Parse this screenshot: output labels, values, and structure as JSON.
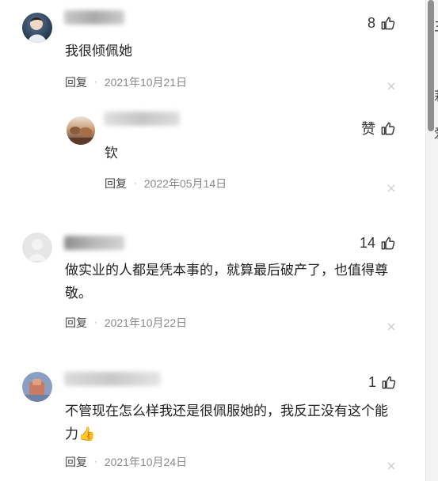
{
  "comments": [
    {
      "likes": "8",
      "text": "我很倾佩她",
      "reply_label": "回复",
      "separator": "·",
      "date": "2021年10月21日",
      "reply": {
        "likes": "赞",
        "text": "钦",
        "reply_label": "回复",
        "separator": "·",
        "date": "2022年05月14日"
      }
    },
    {
      "likes": "14",
      "text": "做实业的人都是凭本事的，就算最后破产了，也值得尊\n敬。",
      "reply_label": "回复",
      "separator": "·",
      "date": "2021年10月22日"
    },
    {
      "likes": "1",
      "text": "不管现在怎么样我还是很佩服她的，我反正没有这个能\n力👍",
      "reply_label": "回复",
      "separator": "·",
      "date": "2021年10月24日"
    }
  ],
  "icons": {
    "like": "thumbs-up-icon",
    "close": "close-icon"
  },
  "edge_fragments": {
    "top": "三",
    "middle": "莉",
    "lower": "爱"
  },
  "colors": {
    "text": "#222222",
    "meta": "#888888",
    "scroll_thumb": "#8f8f8f"
  }
}
